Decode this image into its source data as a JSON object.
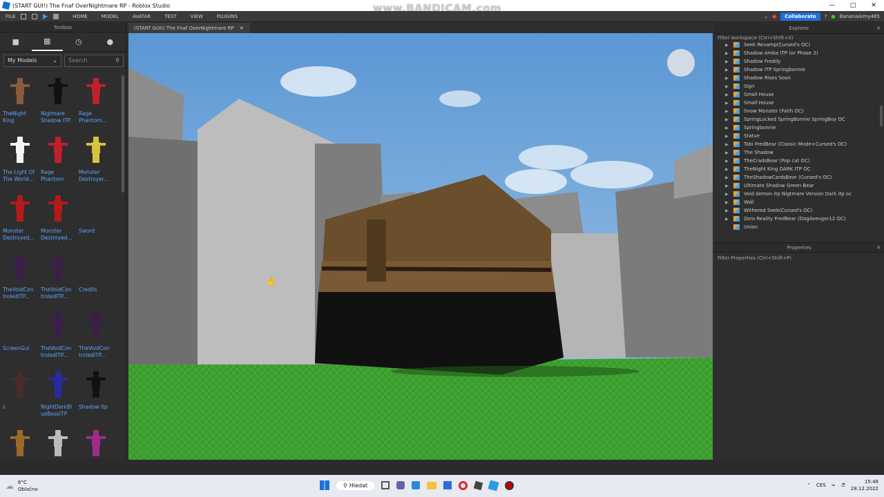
{
  "window": {
    "title": "(START GUI!) The Fnaf OverNightmare RP - Roblox Studio"
  },
  "watermark": "www.BANDICAM.com",
  "menu": {
    "file": "FILE",
    "tabs": [
      "HOME",
      "MODEL",
      "AVATAR",
      "TEST",
      "VIEW",
      "PLUGINS"
    ],
    "collaborate": "Collaborate",
    "user": "BananaArmy465"
  },
  "toolbox": {
    "title": "Toolbox",
    "category": "My Models",
    "search_placeholder": "Search",
    "items": [
      {
        "label": "TheNight King",
        "color": "#8a5a3a"
      },
      {
        "label": "Nigtmare Shadow ITP",
        "color": "#111111"
      },
      {
        "label": "Rage Phantom...",
        "color": "#c0202a"
      },
      {
        "label": "The Light Of The World...",
        "color": "#f5f5f5"
      },
      {
        "label": "Rage Phantom",
        "color": "#c0202a"
      },
      {
        "label": "Monster Destroyer...",
        "color": "#d6c43a"
      },
      {
        "label": "Monster Destroyed...",
        "color": "#b31a1a"
      },
      {
        "label": "Monster Destroyed...",
        "color": "#b31a1a"
      },
      {
        "label": "Sword",
        "color": ""
      },
      {
        "label": "TheVoidCon troledITP...",
        "color": "#3b1e4a"
      },
      {
        "label": "TheVoidCon troledITP...",
        "color": "#3b1e4a"
      },
      {
        "label": "Credits",
        "color": ""
      },
      {
        "label": "ScreenGui",
        "color": ""
      },
      {
        "label": "TheVoidCon troledITP...",
        "color": "#3b1e4a"
      },
      {
        "label": "TheVoidCon troledITP...",
        "color": "#3b1e4a"
      },
      {
        "label": "s",
        "color": "#4a2a2a"
      },
      {
        "label": "NightDarkBl ueBossITP",
        "color": "#2a2aa0"
      },
      {
        "label": "Shadow itp",
        "color": "#111111"
      },
      {
        "label": "",
        "color": "#9a6a2a"
      },
      {
        "label": "",
        "color": "#bbbbbb"
      },
      {
        "label": "",
        "color": "#a02a8a"
      }
    ]
  },
  "viewport": {
    "tab_title": "(START GUI!) The Fnaf OverNightmare RP"
  },
  "explorer": {
    "title": "Explorer",
    "filter": "Filter workspace (Ctrl+Shift+X)",
    "items": [
      "Seek Revamp(Cursed's OC)",
      "Shadow Amba ITP (or Phase 2)",
      "Shadow Freddy",
      "Shadow ITP Springbonnie",
      "Shadow Rises Soon",
      "Sign",
      "Small House",
      "Small House",
      "Snow Monster (Fatih OC)",
      "SpringLocked SpringBonnie SpringBoy OC",
      "Springbonnie",
      "Statue",
      "Tabi FredBear (Classic Mode+Cursed's OC)",
      "The Shadow",
      "TheCradsBear (Pop cat OC)",
      "TheNight King DARK ITP OC",
      "TheShadowCardsBear (Cursed's OC)",
      "Ultimate Shadow Green Bear",
      "Void demon itp Nigtmare Version  Dark itp oc",
      "Wall",
      "Withered Seek(Cursed's OC)",
      "Zero Reality FredBear (DogAvevger12 OC)",
      "Union"
    ]
  },
  "properties": {
    "title": "Properties",
    "filter": "Filter Properties (Ctrl+Shift+P)"
  },
  "taskbar": {
    "weather_temp": "6°C",
    "weather_desc": "Oblačno",
    "search": "Hledat",
    "lang": "CES",
    "time": "15:48",
    "date": "28.12.2022"
  }
}
